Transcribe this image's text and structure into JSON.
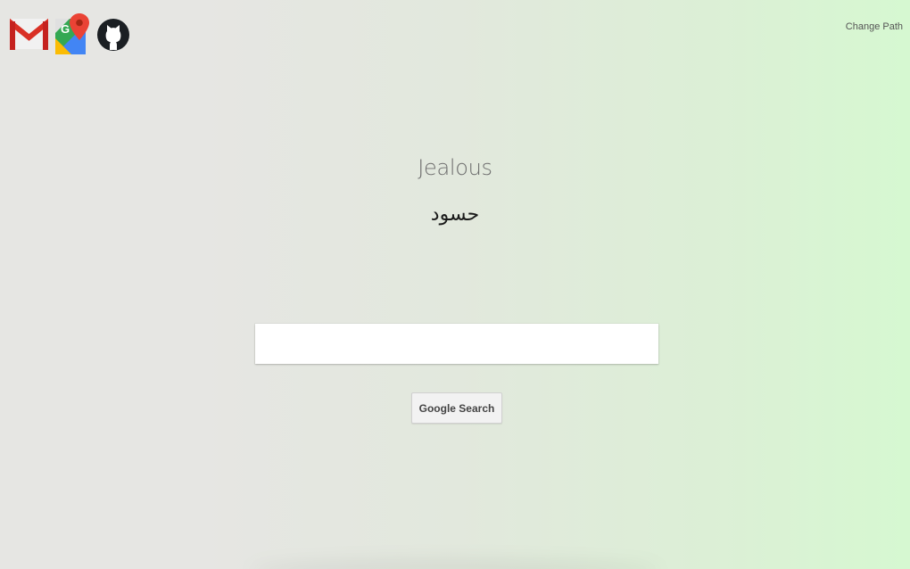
{
  "toolbar": {
    "icons": [
      {
        "name": "gmail-icon",
        "label": "Gmail"
      },
      {
        "name": "google-maps-icon",
        "label": "Google Maps"
      },
      {
        "name": "github-icon",
        "label": "GitHub"
      }
    ],
    "change_path_label": "Change Path"
  },
  "word": {
    "english": "Jealous",
    "arabic": "حسود"
  },
  "search": {
    "value": "",
    "placeholder": "",
    "button_label": "Google Search"
  },
  "colors": {
    "background_left": "#e6e6e3",
    "background_right": "#d6f8d1",
    "gmail_red": "#d93025",
    "maps_green": "#34a853",
    "maps_blue": "#4285f4",
    "maps_yellow": "#fbbc04",
    "github_black": "#1b1f23"
  }
}
